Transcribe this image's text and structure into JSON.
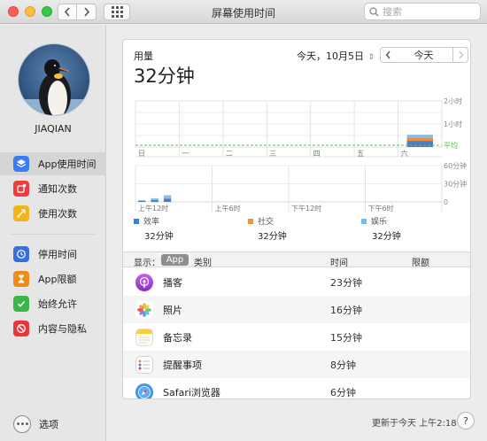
{
  "window": {
    "title": "屏幕使用时间",
    "search_placeholder": "搜索"
  },
  "sidebar": {
    "username": "JIAQIAN",
    "items": [
      {
        "label": "App使用时间",
        "icon": "layers-icon",
        "color": "#3b7df1"
      },
      {
        "label": "通知次数",
        "icon": "notification-icon",
        "color": "#ef3d3d"
      },
      {
        "label": "使用次数",
        "icon": "pickups-icon",
        "color": "#f2b41a"
      },
      {
        "label": "停用时间",
        "icon": "downtime-icon",
        "color": "#3a6fd8"
      },
      {
        "label": "App限额",
        "icon": "hourglass-icon",
        "color": "#f08a1c"
      },
      {
        "label": "始终允许",
        "icon": "checkmark-icon",
        "color": "#39b54a"
      },
      {
        "label": "内容与隐私",
        "icon": "restriction-icon",
        "color": "#e8373a"
      }
    ],
    "options_label": "选项"
  },
  "summary": {
    "label": "用量",
    "total": "32分钟",
    "date": "今天，10月5日",
    "today_button": "今天"
  },
  "chart_data": [
    {
      "type": "bar",
      "categories": [
        "日",
        "一",
        "二",
        "三",
        "四",
        "五",
        "六"
      ],
      "values": [
        0,
        0,
        0,
        0,
        0,
        0,
        32
      ],
      "y_tick_labels": [
        "2小时",
        "1小时"
      ],
      "average_label": "平均",
      "series_colors": [
        "#4b7fc4",
        "#f08a3e",
        "#86c0ea"
      ]
    },
    {
      "type": "bar",
      "categories": [
        "上午12时",
        "上午6时",
        "下午12时",
        "下午6时"
      ],
      "hourly_values_minutes": [
        3,
        6,
        11,
        0,
        0,
        0,
        0,
        0,
        0,
        0,
        0,
        0,
        0,
        0,
        0,
        0,
        0,
        0,
        0,
        0,
        0,
        0,
        0,
        0
      ],
      "y_tick_labels": [
        "60分钟",
        "30分钟",
        "0"
      ]
    }
  ],
  "legend": [
    {
      "name": "效率",
      "value": "32分钟",
      "color": "#3a7fd8"
    },
    {
      "name": "社交",
      "value": "32分钟",
      "color": "#f0943a"
    },
    {
      "name": "娱乐",
      "value": "32分钟",
      "color": "#6cc0f0"
    }
  ],
  "table": {
    "show_label": "显示：",
    "app_pill": "App",
    "category_label": "类别",
    "time_header": "时间",
    "limit_header": "限额",
    "rows": [
      {
        "name": "播客",
        "time": "23分钟",
        "icon": "podcasts-icon"
      },
      {
        "name": "照片",
        "time": "16分钟",
        "icon": "photos-icon"
      },
      {
        "name": "备忘录",
        "time": "15分钟",
        "icon": "notes-icon"
      },
      {
        "name": "提醒事项",
        "time": "8分钟",
        "icon": "reminders-icon"
      },
      {
        "name": "Safari浏览器",
        "time": "6分钟",
        "icon": "safari-icon"
      }
    ]
  },
  "footer": {
    "updated": "更新于今天 上午2:18",
    "help": "?"
  }
}
